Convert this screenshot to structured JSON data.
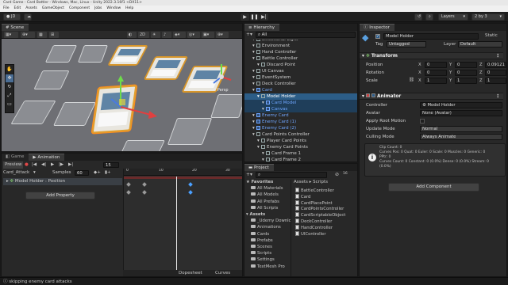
{
  "window": {
    "title": "Card Game - Card Battler - Windows, Mac, Linux - Unity 2022.3.16f1 <DX11>",
    "menu": [
      "File",
      "Edit",
      "Assets",
      "GameObject",
      "Component",
      "Jobs",
      "Window",
      "Help"
    ]
  },
  "toolbar": {
    "account": "JD",
    "layers": "Layers",
    "layout": "2 by 3"
  },
  "scene": {
    "tab": "Scene",
    "mode_2d": "2D",
    "persp": "< Persp"
  },
  "game_tab": "Game",
  "animation": {
    "tab": "Animation",
    "preview": "Preview",
    "frame": "15",
    "clip": "Card_Attack",
    "samples_label": "Samples",
    "samples": "60",
    "track": "Model Holder : Position",
    "add_property": "Add Property",
    "dopesheet": "Dopesheet",
    "curves": "Curves",
    "ruler": [
      "0",
      "10",
      "20",
      "30"
    ]
  },
  "hierarchy": {
    "tab": "Hierarchy",
    "search": "All",
    "rows": [
      {
        "label": "Directional Light",
        "depth": 1
      },
      {
        "label": "Environment",
        "depth": 1
      },
      {
        "label": "Hand Controller",
        "depth": 1
      },
      {
        "label": "Battle Controller",
        "depth": 1
      },
      {
        "label": "Discard Point",
        "depth": 2
      },
      {
        "label": "UI Canvas",
        "depth": 1
      },
      {
        "label": "EventSystem",
        "depth": 1
      },
      {
        "label": "Deck Controller",
        "depth": 1
      },
      {
        "label": "Card",
        "depth": 1,
        "prefab": true
      },
      {
        "label": "Model Holder",
        "depth": 2,
        "selected": true
      },
      {
        "label": "Card Model",
        "depth": 3,
        "prefab": true
      },
      {
        "label": "Canvas",
        "depth": 3,
        "prefab": true
      },
      {
        "label": "Enemy Card",
        "depth": 1,
        "prefab": true
      },
      {
        "label": "Enemy Card (1)",
        "depth": 1,
        "prefab": true
      },
      {
        "label": "Enemy Card (2)",
        "depth": 1,
        "prefab": true
      },
      {
        "label": "Card Points Controller",
        "depth": 1
      },
      {
        "label": "Player Card Points",
        "depth": 2
      },
      {
        "label": "Enemy Card Points",
        "depth": 2
      },
      {
        "label": "Card Frame 1",
        "depth": 3
      },
      {
        "label": "Card Frame 2",
        "depth": 3
      }
    ]
  },
  "project": {
    "tab": "Project",
    "tree": [
      {
        "label": "Favorites",
        "bold": true
      },
      {
        "label": "All Materials"
      },
      {
        "label": "All Models"
      },
      {
        "label": "All Prefabs"
      },
      {
        "label": "All Scripts"
      },
      {
        "label": "Assets",
        "bold": true
      },
      {
        "label": "_Udemy Download"
      },
      {
        "label": "Animations"
      },
      {
        "label": "Cards"
      },
      {
        "label": "Prefabs"
      },
      {
        "label": "Scenes"
      },
      {
        "label": "Scripts"
      },
      {
        "label": "Settings"
      },
      {
        "label": "TextMesh Pro"
      }
    ],
    "breadcrumb": [
      "Assets",
      "Scripts"
    ],
    "files": [
      "BattleController",
      "Card",
      "CardPlacePoint",
      "CardPointsController",
      "CardScriptableObject",
      "DeckController",
      "HandController",
      "UIController"
    ],
    "count": "16"
  },
  "inspector": {
    "tab": "Inspector",
    "name": "Model Holder",
    "static": "Static",
    "tag_label": "Tag",
    "tag": "Untagged",
    "layer_label": "Layer",
    "layer": "Default",
    "transform": {
      "title": "Transform",
      "position_label": "Position",
      "position": {
        "x": "0",
        "y": "0",
        "z": "0.09121"
      },
      "rotation_label": "Rotation",
      "rotation": {
        "x": "0",
        "y": "0",
        "z": "0"
      },
      "scale_label": "Scale",
      "scale": {
        "x": "1",
        "y": "1",
        "z": "1"
      }
    },
    "animator": {
      "title": "Animator",
      "controller_label": "Controller",
      "controller": "Model Holder",
      "avatar_label": "Avatar",
      "avatar": "None (Avatar)",
      "root_motion_label": "Apply Root Motion",
      "update_label": "Update Mode",
      "update": "Normal",
      "culling_label": "Culling Mode",
      "culling": "Always Animate",
      "info": [
        "Clip Count: 0",
        "Curves Pos: 0 Quat: 0 Euler: 0 Scale: 0 Muscles: 0 Generic: 0",
        "PPtr: 0",
        "Curves Count: 0 Constant: 0 (0.0%) Dense: 0 (0.0%) Stream: 0",
        "(0.0%)"
      ]
    },
    "add_component": "Add Component"
  },
  "status": {
    "text": "skipping enemy card attacks"
  },
  "colors": {
    "selection": "#2c5d87",
    "card_border": "#d8962a",
    "record_red": "#c84040",
    "accent_blue": "#4aa0ff"
  }
}
